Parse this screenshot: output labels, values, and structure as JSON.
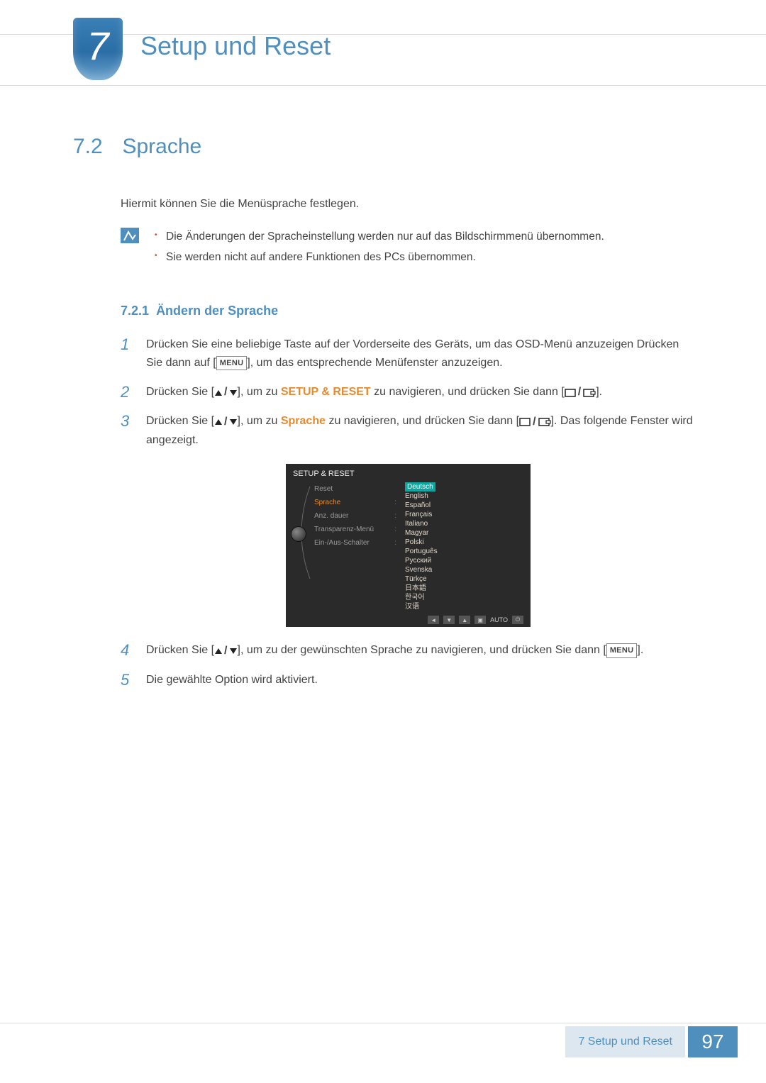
{
  "chapter": {
    "number": "7",
    "title": "Setup und Reset"
  },
  "section": {
    "number": "7.2",
    "title": "Sprache"
  },
  "intro": "Hiermit können Sie die Menüsprache festlegen.",
  "notes": [
    "Die Änderungen der Spracheinstellung werden nur auf das Bildschirmmenü übernommen.",
    "Sie werden nicht auf andere Funktionen des PCs übernommen."
  ],
  "subsection": {
    "number": "7.2.1",
    "title": "Ändern der Sprache"
  },
  "steps": {
    "s1a": "Drücken Sie eine beliebige Taste auf der Vorderseite des Geräts, um das OSD-Menü anzuzeigen",
    "s1b": "Drücken Sie dann auf [",
    "s1c": "], um das entsprechende Menüfenster anzuzeigen.",
    "s2a": "Drücken Sie [",
    "s2b": "], um zu ",
    "s2b_hl": "SETUP & RESET",
    "s2c": " zu navigieren, und drücken Sie dann [",
    "s2d": "].",
    "s3a": "Drücken Sie [",
    "s3b": "], um zu ",
    "s3b_hl": "Sprache",
    "s3c": " zu navigieren, und drücken Sie dann [",
    "s3d": "]. Das folgende Fenster wird angezeigt.",
    "s4a": "Drücken Sie [",
    "s4b": "], um zu der gewünschten Sprache zu navigieren, und drücken Sie dann [",
    "s4c": "].",
    "s5": "Die gewählte Option wird aktiviert."
  },
  "menu_key": "MENU",
  "osd": {
    "title": "SETUP & RESET",
    "items": [
      "Reset",
      "Sprache",
      "Anz. dauer",
      "Transparenz-Menü",
      "Ein-/Aus-Schalter"
    ],
    "active_index": 1,
    "langs": [
      "Deutsch",
      "English",
      "Español",
      "Français",
      "Italiano",
      "Magyar",
      "Polski",
      "Português",
      "Русский",
      "Svenska",
      "Türkçe",
      "日本語",
      "한국어",
      "汉语"
    ],
    "selected_lang_index": 0,
    "auto_label": "AUTO"
  },
  "footer": {
    "label": "7 Setup und Reset",
    "page": "97"
  }
}
